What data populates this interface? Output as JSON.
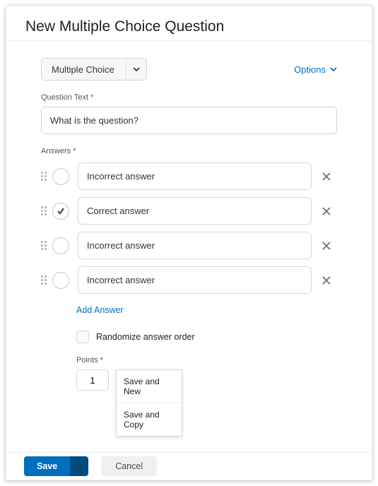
{
  "title": "New Multiple Choice Question",
  "type_select": {
    "value": "Multiple Choice"
  },
  "options_link": "Options",
  "question": {
    "label": "Question Text *",
    "value": "What is the question?"
  },
  "answers_label": "Answers *",
  "answers": [
    {
      "text": "Incorrect answer",
      "correct": false
    },
    {
      "text": "Correct answer",
      "correct": true
    },
    {
      "text": "Incorrect answer",
      "correct": false
    },
    {
      "text": "Incorrect answer",
      "correct": false
    }
  ],
  "add_answer": "Add Answer",
  "randomize": {
    "label": "Randomize answer order",
    "checked": false
  },
  "points": {
    "label": "Points *",
    "value": "1"
  },
  "save_menu": {
    "items": [
      "Save and New",
      "Save and Copy"
    ]
  },
  "footer": {
    "save": "Save",
    "cancel": "Cancel"
  }
}
